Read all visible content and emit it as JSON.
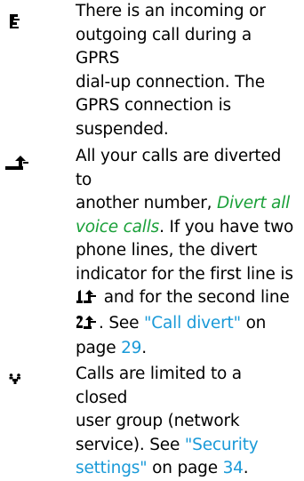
{
  "entries": [
    {
      "icon": "gprs-call-suspended-icon",
      "lines": [
        "There is an incoming or",
        "outgoing call during a GPRS",
        "dial-up connection. The",
        "GPRS connection is",
        "suspended."
      ]
    },
    {
      "icon": "divert-icon",
      "line1": "All your calls are diverted to",
      "line2": "another number,",
      "divert_link_a": "Divert all",
      "divert_link_b": "voice calls",
      "line3_tail": ". If you have two",
      "line4": "phone lines, the divert",
      "line5": "indicator for the first line is",
      "line6_tail": "and for the second line",
      "line7_pre": ". See",
      "call_divert_link": "\"Call divert\"",
      "line7_tail": "on",
      "line8_pre": "page",
      "page_ref": "29",
      "line8_tail": ".",
      "line1_icon": "divert-line-1-icon",
      "line2_icon": "divert-line-2-icon"
    },
    {
      "icon": "closed-user-group-icon",
      "line1": "Calls are limited to a closed",
      "line2": "user group (network",
      "line3_pre": "service). See",
      "security_link_a": "\"Security",
      "security_link_b": "settings\"",
      "line4_mid": "on page",
      "page_ref": "34",
      "line4_tail": "."
    }
  ],
  "colors": {
    "link": "#1a9ad8",
    "emphasis_link": "#1aa039"
  }
}
